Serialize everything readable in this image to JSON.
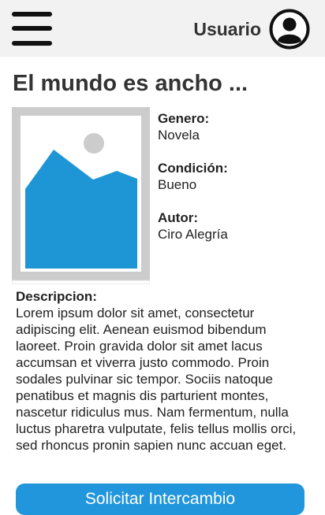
{
  "header": {
    "menu_icon": "hamburger-menu-icon",
    "user_label": "Usuario",
    "avatar_icon": "user-avatar-icon"
  },
  "book": {
    "title": "El mundo es ancho ...",
    "cover_icon": "image-placeholder-icon",
    "genre_label": "Genero:",
    "genre_value": "Novela",
    "condition_label": "Condición:",
    "condition_value": "Bueno",
    "author_label": "Autor:",
    "author_value": "Ciro Alegría",
    "description_label": "Descripcion:",
    "description_text": "Lorem ipsum dolor sit amet, consectetur adipiscing elit. Aenean euismod bibendum laoreet. Proin gravida dolor sit amet lacus accumsan et viverra justo commodo. Proin sodales pulvinar sic tempor. Sociis natoque penatibus et magnis dis parturient montes, nascetur ridiculus mus. Nam fermentum, nulla luctus pharetra vulputate, felis tellus mollis orci, sed rhoncus pronin sapien nunc accuan eget."
  },
  "actions": {
    "request_exchange_label": "Solicitar Intercambio"
  },
  "colors": {
    "header_background": "#f2f2f2",
    "accent": "#2196dc",
    "placeholder_frame": "#cccccc"
  }
}
